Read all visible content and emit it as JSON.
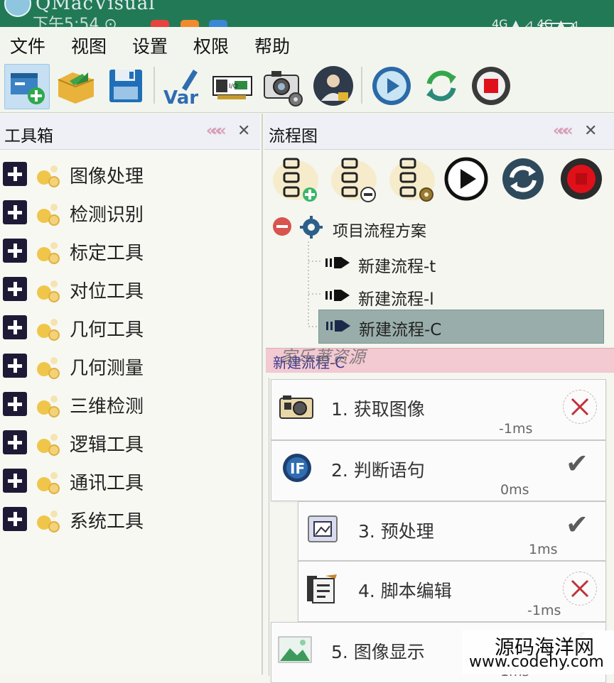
{
  "titlebar": {
    "app_title": "QMacVisual",
    "status_left": "下午5:54 ⊙",
    "status_right": "4G ▲ ⊿ 4G ▲ ⊿"
  },
  "menu": {
    "items": [
      {
        "label": "文件"
      },
      {
        "label": "视图"
      },
      {
        "label": "设置"
      },
      {
        "label": "权限"
      },
      {
        "label": "帮助"
      }
    ]
  },
  "toolbar": {
    "buttons": [
      {
        "name": "new-project-icon"
      },
      {
        "name": "open-project-icon"
      },
      {
        "name": "save-icon"
      },
      {
        "name": "variable-icon",
        "text": "Var"
      },
      {
        "name": "io-card-icon",
        "text": "I/O"
      },
      {
        "name": "camera-settings-icon"
      },
      {
        "name": "user-permission-icon"
      },
      {
        "name": "run-icon"
      },
      {
        "name": "loop-run-icon"
      },
      {
        "name": "stop-icon"
      }
    ]
  },
  "toolbox": {
    "title": "工具箱",
    "collapse": "«",
    "close": "✕",
    "items": [
      {
        "label": "图像处理"
      },
      {
        "label": "检测识别"
      },
      {
        "label": "标定工具"
      },
      {
        "label": "对位工具"
      },
      {
        "label": "几何工具"
      },
      {
        "label": "几何测量"
      },
      {
        "label": "三维检测"
      },
      {
        "label": "逻辑工具"
      },
      {
        "label": "通讯工具"
      },
      {
        "label": "系统工具"
      }
    ]
  },
  "flowchart": {
    "title": "流程图",
    "collapse": "«",
    "close": "✕",
    "tree": {
      "root_label": "项目流程方案",
      "nodes": [
        {
          "label": "新建流程-t",
          "selected": false
        },
        {
          "label": "新建流程-l",
          "selected": false
        },
        {
          "label": "新建流程-C",
          "selected": true
        }
      ]
    },
    "active_tab": "新建流程-C",
    "overlay_text": "家乐著资源",
    "steps": [
      {
        "label": "1. 获取图像",
        "time": "-1ms",
        "status": "fail"
      },
      {
        "label": "2. 判断语句",
        "time": "0ms",
        "status": "ok"
      },
      {
        "label": "3. 预处理",
        "time": "1ms",
        "status": "ok"
      },
      {
        "label": "4. 脚本编辑",
        "time": "-1ms",
        "status": "fail"
      },
      {
        "label": "5. 图像显示",
        "time": "1ms",
        "status": "ok"
      }
    ]
  },
  "watermark": {
    "line1": "源码海洋网",
    "line2": "www.codehy.com"
  },
  "colors": {
    "title_bar": "#217a55",
    "selected_node": "#99aeaa",
    "flow_tab": "#f3c9d2",
    "stop_red": "#e0101a",
    "run_blue": "#2b6aa8"
  }
}
